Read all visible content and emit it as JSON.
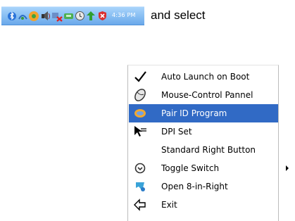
{
  "tray": {
    "time": "4:36 PM",
    "icons": [
      "bluetooth-icon",
      "network-icon",
      "media-icon",
      "volume-icon",
      "network-error-icon",
      "device-icon",
      "clock-icon",
      "update-icon",
      "security-icon"
    ]
  },
  "caption": "and select",
  "menu": {
    "items": [
      {
        "label": "Auto Launch on Boot",
        "icon": "checkmark-icon"
      },
      {
        "label": "Mouse-Control Pannel",
        "icon": "mouse-icon"
      },
      {
        "label": "Pair ID Program",
        "icon": "pair-icon",
        "selected": true
      },
      {
        "label": "DPI Set",
        "icon": "cursor-icon"
      },
      {
        "label": "Standard Right Button",
        "icon": ""
      },
      {
        "label": "Toggle Switch",
        "icon": "toggle-icon",
        "submenu": true
      },
      {
        "label": "Open 8-in-Right",
        "icon": "app-icon"
      },
      {
        "label": "Exit",
        "icon": "exit-icon"
      }
    ]
  }
}
